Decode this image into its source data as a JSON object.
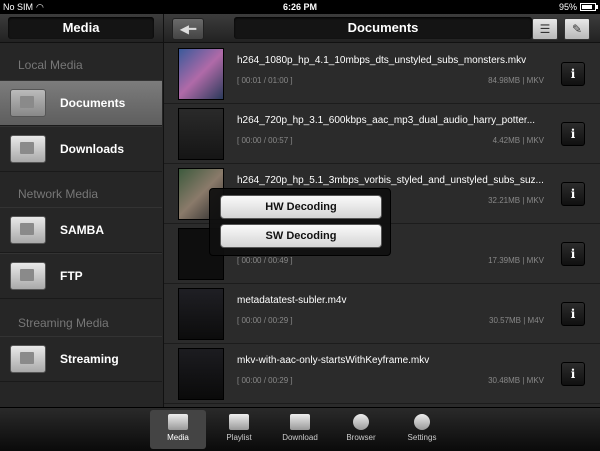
{
  "status_bar": {
    "carrier": "No SIM",
    "wifi_icon": "wifi-icon",
    "time": "6:26 PM",
    "battery": "95%",
    "battery_icon": "battery-icon"
  },
  "sidebar": {
    "title": "Media",
    "sections": [
      {
        "label": "Local Media",
        "items": [
          {
            "label": "Documents",
            "icon": "documents-folder-icon",
            "active": true
          },
          {
            "label": "Downloads",
            "icon": "downloads-folder-icon",
            "active": false
          }
        ]
      },
      {
        "label": "Network Media",
        "items": [
          {
            "label": "SAMBA",
            "icon": "samba-server-icon",
            "active": false
          },
          {
            "label": "FTP",
            "icon": "ftp-server-icon",
            "active": false
          }
        ]
      },
      {
        "label": "Streaming Media",
        "items": [
          {
            "label": "Streaming",
            "icon": "streaming-icon",
            "active": false
          }
        ]
      }
    ]
  },
  "header": {
    "title": "Documents",
    "back_icon": "back-arrow-icon",
    "sort_icon": "sort-list-icon",
    "edit_icon": "edit-icon"
  },
  "files": [
    {
      "name": "h264_1080p_hp_4.1_10mbps_dts_unstyled_subs_monsters.mkv",
      "duration": "[ 00:01 / 01:00 ]",
      "size": "84.98MB | MKV"
    },
    {
      "name": "h264_720p_hp_3.1_600kbps_aac_mp3_dual_audio_harry_potter...",
      "duration": "[ 00:00 / 00:57 ]",
      "size": "4.42MB | MKV"
    },
    {
      "name": "h264_720p_hp_5.1_3mbps_vorbis_styled_and_unstyled_subs_suz...",
      "duration": "",
      "size": "32.21MB | MKV"
    },
    {
      "name": "",
      "duration": "[ 00:00 / 00:49 ]",
      "size": "17.39MB | MKV"
    },
    {
      "name": "metadatatest-subler.m4v",
      "duration": "[ 00:00 / 00:29 ]",
      "size": "30.57MB | M4V"
    },
    {
      "name": "mkv-with-aac-only-startsWithKeyframe.mkv",
      "duration": "[ 00:00 / 00:29 ]",
      "size": "30.48MB | MKV"
    }
  ],
  "info_label": "i",
  "popup": {
    "hw_label": "HW Decoding",
    "sw_label": "SW Decoding"
  },
  "tabbar": {
    "tabs": [
      {
        "label": "Media",
        "icon": "media-icon",
        "active": true
      },
      {
        "label": "Playlist",
        "icon": "playlist-icon",
        "active": false
      },
      {
        "label": "Download",
        "icon": "download-icon",
        "active": false
      },
      {
        "label": "Browser",
        "icon": "globe-icon",
        "active": false
      },
      {
        "label": "Settings",
        "icon": "gear-icon",
        "active": false
      }
    ]
  }
}
